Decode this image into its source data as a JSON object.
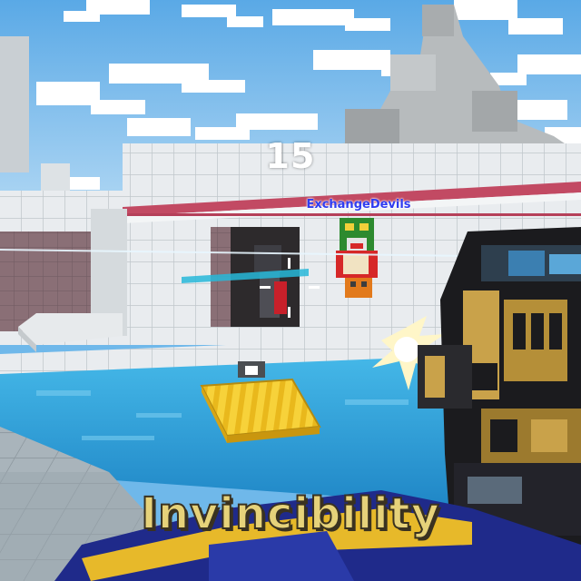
{
  "hud": {
    "counter": "15",
    "player_name": "ExchangeDevils",
    "powerup_label": "Invincibility"
  },
  "colors": {
    "sky": "#6fb8ea",
    "water": "#2a9fd6",
    "raft": "#f5cf2a",
    "player_tag": "#2f3cf0",
    "banner": "#e6d27a",
    "weapon_gold": "#c9a24a"
  },
  "icons": {
    "crosshair": "crosshair-icon"
  }
}
